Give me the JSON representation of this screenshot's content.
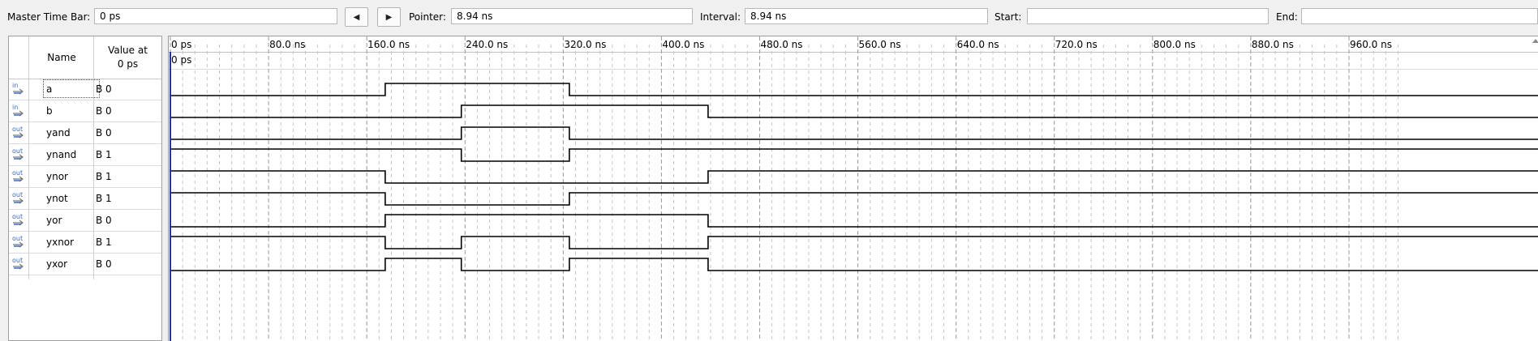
{
  "toolbar": {
    "master_time_bar_label": "Master Time Bar:",
    "master_time_bar_value": "0 ps",
    "prev_button_icon": "triangle-left-icon",
    "next_button_icon": "triangle-right-icon",
    "pointer_label": "Pointer:",
    "pointer_value": "8.94 ns",
    "interval_label": "Interval:",
    "interval_value": "8.94 ns",
    "start_label": "Start:",
    "start_value": "",
    "end_label": "End:",
    "end_value": ""
  },
  "signal_panel": {
    "name_header": "Name",
    "value_header_line1": "Value at",
    "value_header_line2": "0 ps",
    "signals": [
      {
        "direction": "in",
        "name": "a",
        "value": "B 0",
        "transitions_ns": [
          0,
          175,
          325
        ],
        "levels": [
          0,
          1,
          0
        ]
      },
      {
        "direction": "in",
        "name": "b",
        "value": "B 0",
        "transitions_ns": [
          0,
          237,
          438
        ],
        "levels": [
          0,
          1,
          0
        ]
      },
      {
        "direction": "out",
        "name": "yand",
        "value": "B 0",
        "transitions_ns": [
          0,
          237,
          325
        ],
        "levels": [
          0,
          1,
          0
        ]
      },
      {
        "direction": "out",
        "name": "ynand",
        "value": "B 1",
        "transitions_ns": [
          0,
          237,
          325
        ],
        "levels": [
          1,
          0,
          1
        ]
      },
      {
        "direction": "out",
        "name": "ynor",
        "value": "B 1",
        "transitions_ns": [
          0,
          175,
          438
        ],
        "levels": [
          1,
          0,
          1
        ]
      },
      {
        "direction": "out",
        "name": "ynot",
        "value": "B 1",
        "transitions_ns": [
          0,
          175,
          325
        ],
        "levels": [
          1,
          0,
          1
        ]
      },
      {
        "direction": "out",
        "name": "yor",
        "value": "B 0",
        "transitions_ns": [
          0,
          175,
          438
        ],
        "levels": [
          0,
          1,
          0
        ]
      },
      {
        "direction": "out",
        "name": "yxnor",
        "value": "B 1",
        "transitions_ns": [
          0,
          175,
          237,
          325,
          438
        ],
        "levels": [
          1,
          0,
          1,
          0,
          1
        ]
      },
      {
        "direction": "out",
        "name": "yxor",
        "value": "B 0",
        "transitions_ns": [
          0,
          175,
          237,
          325,
          438
        ],
        "levels": [
          0,
          1,
          0,
          1,
          0
        ]
      }
    ]
  },
  "timeline": {
    "ticks": [
      "0 ps",
      "80.0 ns",
      "160.0 ns",
      "240.0 ns",
      "320.0 ns",
      "400.0 ns",
      "480.0 ns",
      "560.0 ns",
      "640.0 ns",
      "720.0 ns",
      "800.0 ns",
      "880.0 ns",
      "960.0 ns"
    ],
    "tick_values_ns": [
      0,
      80,
      160,
      240,
      320,
      400,
      480,
      560,
      640,
      720,
      800,
      880,
      960
    ],
    "time_range_ns": [
      0,
      1000
    ],
    "cursor_label": "0 ps",
    "cursor_time_ns": 0,
    "minor_grid_ns": 10
  },
  "colors": {
    "cursor": "#1f2ec8",
    "waveform": "#000000",
    "grid_major": "#9a9a9a",
    "grid_minor": "#c4c4c4",
    "in_icon": "#3a6bc4",
    "out_icon": "#3a6bc4"
  }
}
